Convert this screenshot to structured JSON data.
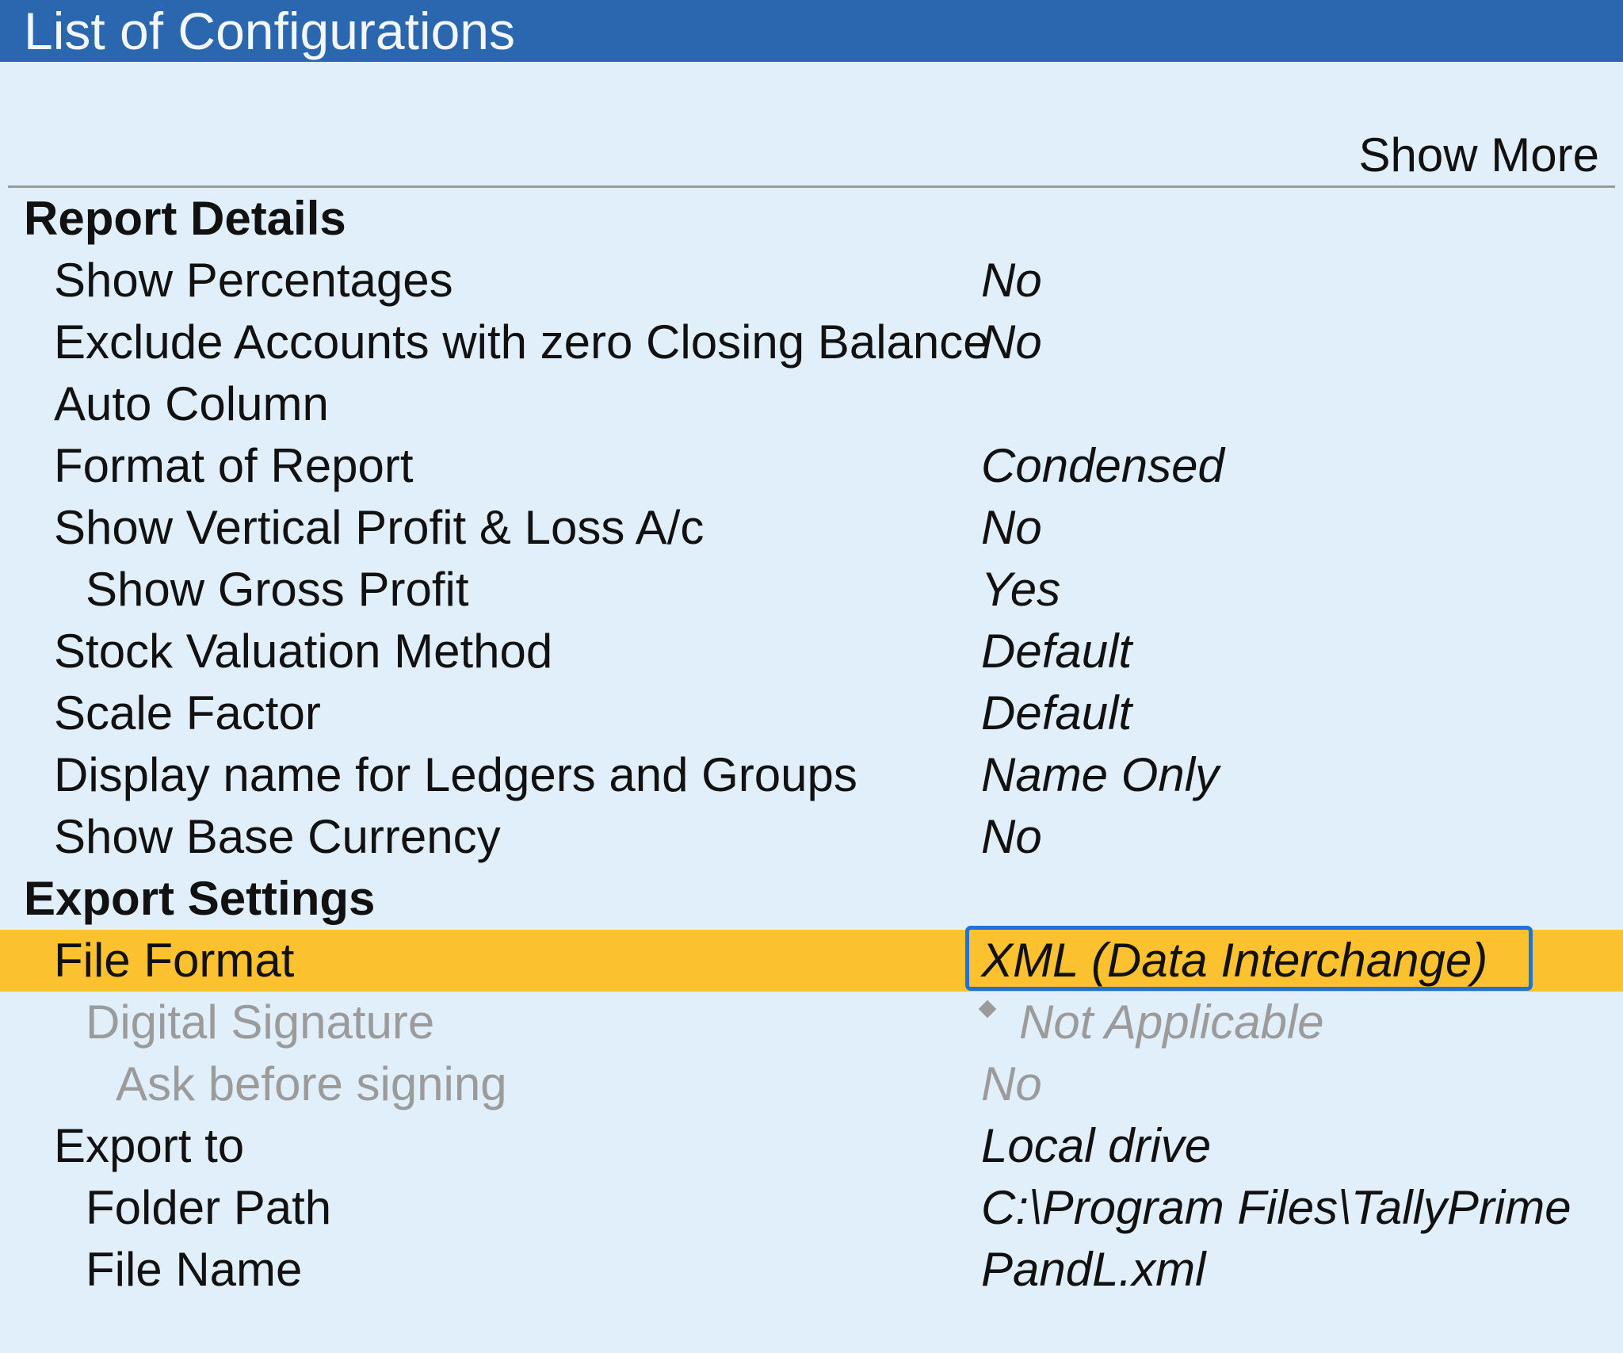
{
  "window": {
    "title": "List of Configurations"
  },
  "toolbar": {
    "show_more": "Show More"
  },
  "sections": {
    "report_details": "Report Details",
    "export_settings": "Export Settings"
  },
  "rows": {
    "show_percentages": {
      "label": "Show Percentages",
      "value": "No"
    },
    "exclude_zero": {
      "label": "Exclude Accounts with zero Closing Balance",
      "value": "No"
    },
    "auto_column": {
      "label": "Auto Column",
      "value": ""
    },
    "format_of_report": {
      "label": "Format of Report",
      "value": "Condensed"
    },
    "vertical_pl": {
      "label": "Show Vertical Profit & Loss A/c",
      "value": "No"
    },
    "gross_profit": {
      "label": "Show Gross Profit",
      "value": "Yes"
    },
    "stock_valuation": {
      "label": "Stock Valuation Method",
      "value": "Default"
    },
    "scale_factor": {
      "label": "Scale Factor",
      "value": "Default"
    },
    "display_name": {
      "label": "Display name for Ledgers and Groups",
      "value": "Name Only"
    },
    "base_currency": {
      "label": "Show Base Currency",
      "value": "No"
    },
    "file_format": {
      "label": "File Format",
      "value": "XML (Data Interchange)"
    },
    "digital_signature": {
      "label": "Digital Signature",
      "value": "Not Applicable"
    },
    "ask_before_signing": {
      "label": "Ask before signing",
      "value": "No"
    },
    "export_to": {
      "label": "Export to",
      "value": "Local drive"
    },
    "folder_path": {
      "label": "Folder Path",
      "value": "C:\\Program Files\\TallyPrime"
    },
    "file_name": {
      "label": "File Name",
      "value": "PandL.xml"
    }
  },
  "colors": {
    "titlebar": "#2a67ae",
    "background": "#e1effa",
    "highlight": "#fcc12f",
    "focus_border": "#1c74d8",
    "disabled_text": "#9b9b9b"
  },
  "icons": {
    "digital_signature_marker": "diamond-icon"
  }
}
